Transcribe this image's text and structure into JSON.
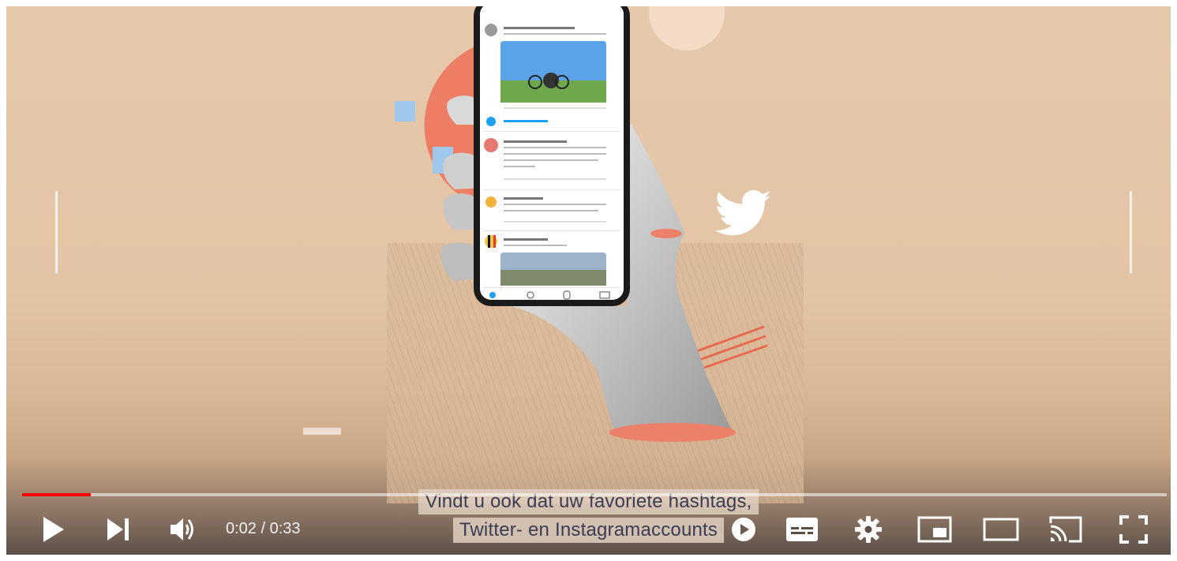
{
  "player": {
    "current_time": "0:02",
    "time_separator": " / ",
    "duration": "0:33",
    "progress_fraction": 0.06,
    "progress_color": "#ff0000",
    "state": "paused"
  },
  "captions": {
    "line1": "Vindt u ook dat uw favoriete hashtags,",
    "line2": "Twitter- en Instagramaccounts"
  },
  "controls": [
    {
      "name": "play-button",
      "icon": "play-icon"
    },
    {
      "name": "next-button",
      "icon": "skip-next-icon"
    },
    {
      "name": "volume-button",
      "icon": "speaker-icon"
    },
    {
      "name": "autoplay-toggle",
      "icon": "autoplay-toggle-icon"
    },
    {
      "name": "subtitles-button",
      "icon": "captions-icon"
    },
    {
      "name": "settings-button",
      "icon": "gear-icon"
    },
    {
      "name": "miniplayer-button",
      "icon": "miniplayer-icon"
    },
    {
      "name": "theater-button",
      "icon": "theater-mode-icon"
    },
    {
      "name": "cast-button",
      "icon": "cast-icon"
    },
    {
      "name": "fullscreen-button",
      "icon": "fullscreen-icon"
    }
  ],
  "video_frame": {
    "background_color": "#e5c7a9",
    "accent_color": "#ee7e63",
    "twitter_bird_color": "#ffffff"
  }
}
